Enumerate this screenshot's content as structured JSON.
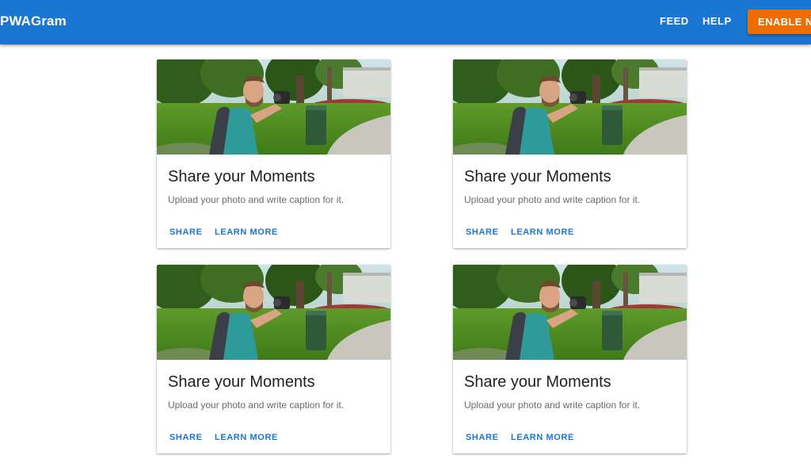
{
  "header": {
    "title": "PWAGram",
    "nav": {
      "feed_label": "FEED",
      "help_label": "HELP",
      "enable_notifications_label": "ENABLE NOTIFICATIONS"
    },
    "colors": {
      "primary": "#1976d2",
      "accent": "#ef6c00"
    }
  },
  "cards": [
    {
      "image": "photo of a man with a camera in a park",
      "title": "Share your Moments",
      "text": "Upload your photo and write caption for it.",
      "actions": [
        "SHARE",
        "LEARN MORE"
      ]
    },
    {
      "image": "photo of a man with a camera in a park",
      "title": "Share your Moments",
      "text": "Upload your photo and write caption for it.",
      "actions": [
        "SHARE",
        "LEARN MORE"
      ]
    },
    {
      "image": "photo of a man with a camera in a park",
      "title": "Share your Moments",
      "text": "Upload your photo and write caption for it.",
      "actions": [
        "SHARE",
        "LEARN MORE"
      ]
    },
    {
      "image": "photo of a man with a camera in a park",
      "title": "Share your Moments",
      "text": "Upload your photo and write caption for it.",
      "actions": [
        "SHARE",
        "LEARN MORE"
      ]
    }
  ]
}
